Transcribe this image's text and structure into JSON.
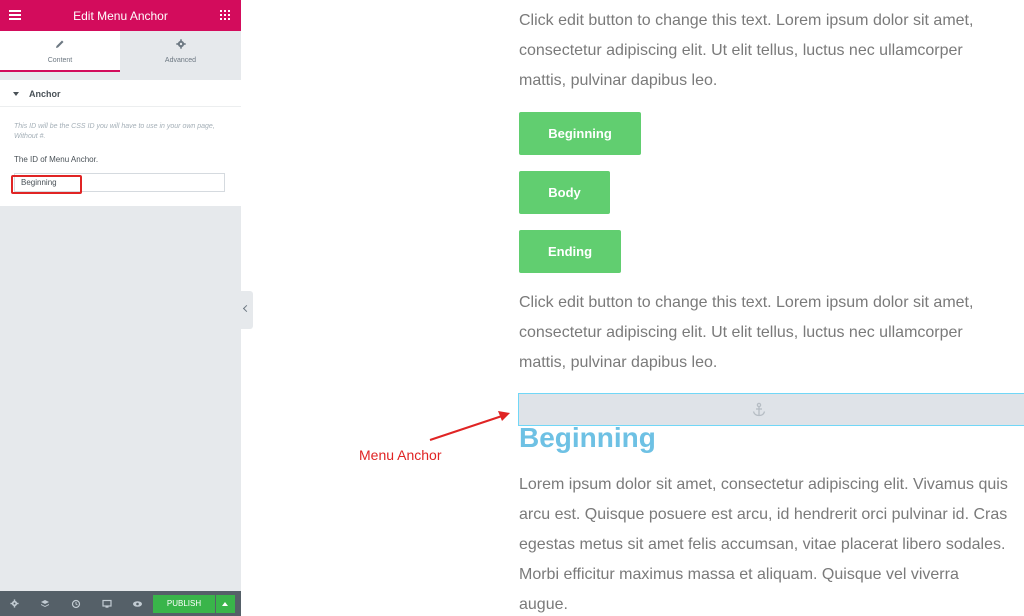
{
  "panel": {
    "header_title": "Edit Menu Anchor",
    "tabs": [
      {
        "label": "Content",
        "icon": "pencil-icon"
      },
      {
        "label": "Advanced",
        "icon": "gear-icon"
      }
    ],
    "section_title": "Anchor",
    "help_text": "This ID will be the CSS ID you will have to use in your own page, Without #.",
    "field_label": "The ID of Menu Anchor.",
    "field_value": "Beginning"
  },
  "footer": {
    "icons": [
      "settings-icon",
      "layers-icon",
      "history-icon",
      "responsive-icon",
      "preview-icon"
    ],
    "publish_label": "PUBLISH"
  },
  "canvas": {
    "paragraph1": "Click edit button to change this text. Lorem ipsum dolor sit amet, consectetur adipiscing elit. Ut elit tellus, luctus nec ullamcorper mattis, pulvinar dapibus leo.",
    "buttons": [
      "Beginning",
      "Body",
      "Ending"
    ],
    "paragraph2": "Click edit button to change this text. Lorem ipsum dolor sit amet, consectetur adipiscing elit. Ut elit tellus, luctus nec ullamcorper mattis, pulvinar dapibus leo.",
    "heading": "Beginning",
    "paragraph3": "Lorem ipsum dolor sit amet, consectetur adipiscing elit. Vivamus quis arcu est. Quisque posuere est arcu, id hendrerit orci pulvinar id. Cras egestas metus sit amet felis accumsan, vitae placerat libero sodales. Morbi efficitur maximus massa et aliquam. Quisque vel viverra augue."
  },
  "annotation": {
    "label": "Menu Anchor"
  },
  "colors": {
    "header": "#d30c5c",
    "button_green": "#61ce70",
    "publish_green": "#39b54a",
    "heading_blue": "#6ec1e4",
    "annotation_red": "#e02424"
  }
}
